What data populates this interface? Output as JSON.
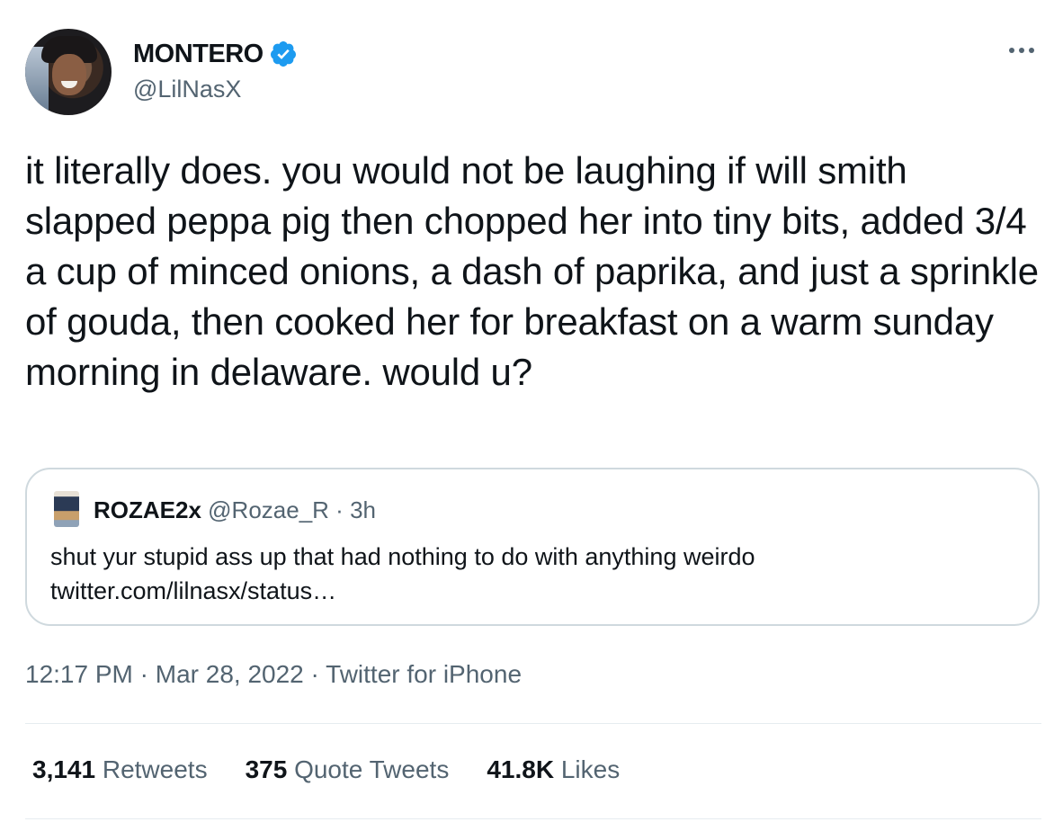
{
  "author": {
    "display_name": "MONTERO",
    "handle": "@LilNasX",
    "verified": true
  },
  "tweet": {
    "text": "it literally does. you would not be laughing if will smith slapped peppa pig then chopped her into tiny bits, added 3/4 a cup of minced onions, a dash of paprika, and just a sprinkle of gouda, then cooked her for breakfast on a warm sunday morning in delaware. would u?"
  },
  "quote": {
    "display_name": "ROZAE2x",
    "handle": "@Rozae_R",
    "age": "3h",
    "text_line1": "shut yur stupid ass up that had nothing to do with anything weirdo",
    "text_line2": "twitter.com/lilnasx/status…"
  },
  "meta": {
    "time": "12:17 PM",
    "date": "Mar 28, 2022",
    "source": "Twitter for iPhone",
    "separator": " · "
  },
  "stats": {
    "retweets": {
      "count": "3,141",
      "label": "Retweets"
    },
    "quotes": {
      "count": "375",
      "label": "Quote Tweets"
    },
    "likes": {
      "count": "41.8K",
      "label": "Likes"
    }
  },
  "colors": {
    "text": "#0f1419",
    "secondary": "#536471",
    "verified": "#1d9bf0",
    "border": "#cfd9de"
  },
  "icons": {
    "verified": "verified-badge-icon",
    "more": "more-horizontal-icon"
  }
}
